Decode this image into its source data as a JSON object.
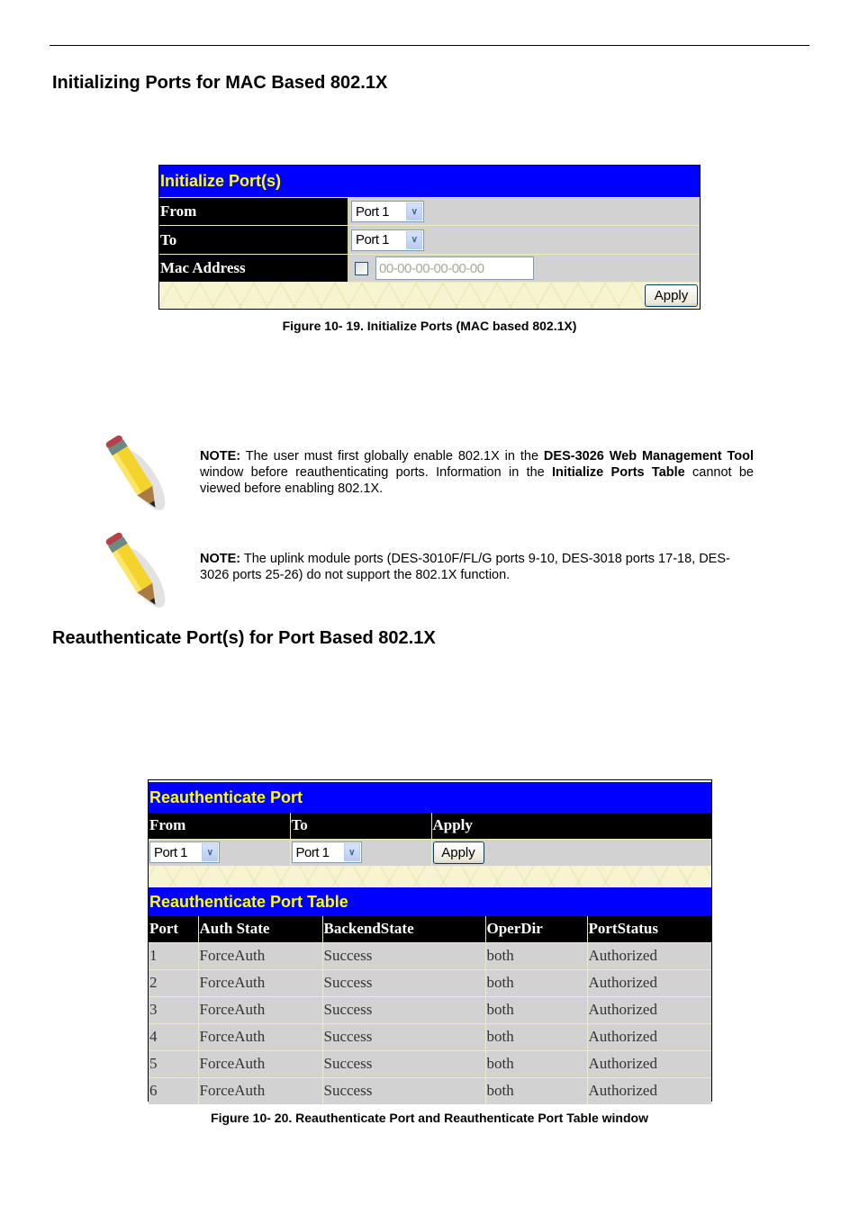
{
  "section1": {
    "heading": "Initializing Ports for MAC Based 802.1X",
    "panel": {
      "title": "Initialize Port(s)",
      "rows": [
        {
          "label": "From",
          "select_value": "Port 1"
        },
        {
          "label": "To",
          "select_value": "Port 1"
        },
        {
          "label": "Mac Address",
          "checkbox_checked": false,
          "input_placeholder": "00-00-00-00-00-00"
        }
      ],
      "apply_label": "Apply"
    },
    "caption": "Figure 10- 19. Initialize Ports (MAC based 802.1X)"
  },
  "notes": [
    {
      "icon": "pencil-icon",
      "prefix": "NOTE:",
      "parts": [
        {
          "t": " The user must first globally enable 802.1X in the ",
          "b": false
        },
        {
          "t": "DES-3026 Web Management Tool",
          "b": true
        },
        {
          "t": " window before reauthenticating ports. Information in the ",
          "b": false
        },
        {
          "t": "Initialize Ports Table",
          "b": true
        },
        {
          "t": " cannot be viewed before enabling 802.1X.",
          "b": false
        }
      ]
    },
    {
      "icon": "pencil-icon",
      "prefix": "NOTE:",
      "parts": [
        {
          "t": " The uplink module ports (DES-3010F/FL/G ports 9-10, DES-3018 ports 17-18, DES-3026 ports 25-26) do not support the 802.1X function.",
          "b": false
        }
      ]
    }
  ],
  "section2": {
    "heading": "Reauthenticate Port(s) for Port Based 802.1X",
    "panel": {
      "title": "Reauthenticate Port",
      "columns": [
        "From",
        "To",
        "Apply"
      ],
      "from_value": "Port 1",
      "to_value": "Port 1",
      "apply_label": "Apply"
    },
    "table": {
      "title": "Reauthenticate Port Table",
      "columns": [
        "Port",
        "Auth State",
        "BackendState",
        "OperDir",
        "PortStatus"
      ],
      "rows": [
        [
          "1",
          "ForceAuth",
          "Success",
          "both",
          "Authorized"
        ],
        [
          "2",
          "ForceAuth",
          "Success",
          "both",
          "Authorized"
        ],
        [
          "3",
          "ForceAuth",
          "Success",
          "both",
          "Authorized"
        ],
        [
          "4",
          "ForceAuth",
          "Success",
          "both",
          "Authorized"
        ],
        [
          "5",
          "ForceAuth",
          "Success",
          "both",
          "Authorized"
        ],
        [
          "6",
          "ForceAuth",
          "Success",
          "both",
          "Authorized"
        ]
      ]
    },
    "caption": "Figure 10- 20. Reauthenticate Port and Reauthenticate Port Table window"
  },
  "colors": {
    "title_bar": "#0000ff",
    "title_text": "#ffff00",
    "label_bg": "#000000",
    "value_bg": "#d2d2d2"
  }
}
